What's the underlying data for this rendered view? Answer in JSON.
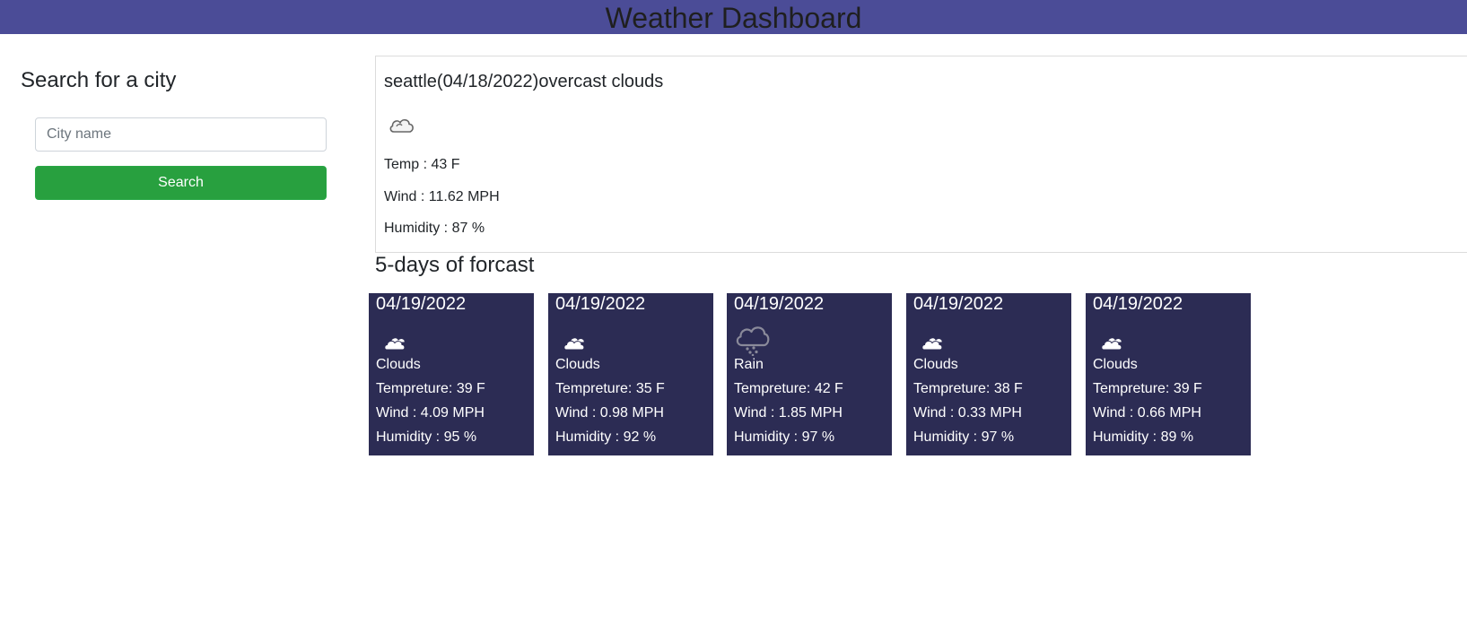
{
  "header": {
    "title": "Weather Dashboard"
  },
  "search": {
    "heading": "Search for a city",
    "placeholder": "City name",
    "button_label": "Search"
  },
  "current": {
    "title": "seattle(04/18/2022)overcast clouds",
    "icon": "cloud-icon",
    "temp": "Temp : 43 F",
    "wind": "Wind : 11.62 MPH",
    "humidity": "Humidity : 87 %"
  },
  "forecast": {
    "heading": "5-days of forcast",
    "days": [
      {
        "date": "04/19/2022",
        "icon": "cloud-icon",
        "condition": "Clouds",
        "temp": "Tempreture: 39 F",
        "wind": "Wind : 4.09 MPH",
        "humidity": "Humidity : 95 %"
      },
      {
        "date": "04/19/2022",
        "icon": "cloud-icon",
        "condition": "Clouds",
        "temp": "Tempreture: 35 F",
        "wind": "Wind : 0.98 MPH",
        "humidity": "Humidity : 92 %"
      },
      {
        "date": "04/19/2022",
        "icon": "rain-icon",
        "condition": "Rain",
        "temp": "Tempreture: 42 F",
        "wind": "Wind : 1.85 MPH",
        "humidity": "Humidity : 97 %"
      },
      {
        "date": "04/19/2022",
        "icon": "cloud-icon",
        "condition": "Clouds",
        "temp": "Tempreture: 38 F",
        "wind": "Wind : 0.33 MPH",
        "humidity": "Humidity : 97 %"
      },
      {
        "date": "04/19/2022",
        "icon": "cloud-icon",
        "condition": "Clouds",
        "temp": "Tempreture: 39 F",
        "wind": "Wind : 0.66 MPH",
        "humidity": "Humidity : 89 %"
      }
    ]
  },
  "colors": {
    "header_bg": "#4b4c97",
    "button_bg": "#28a03f",
    "card_bg": "#2c2c54"
  }
}
